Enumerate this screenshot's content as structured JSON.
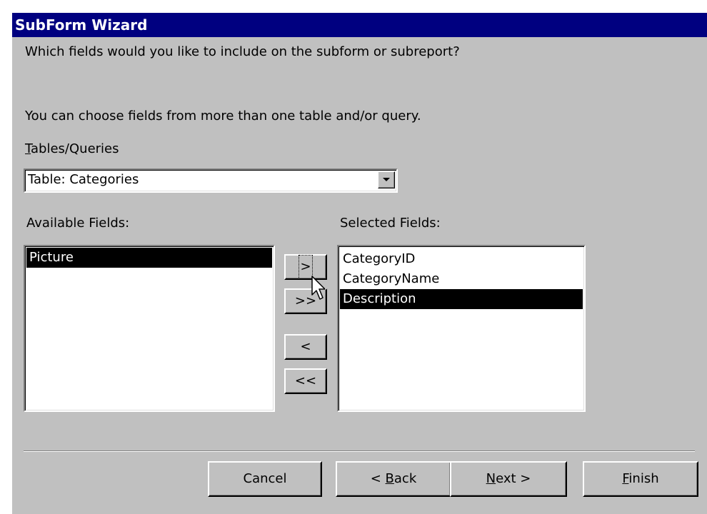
{
  "window": {
    "title": "SubForm Wizard"
  },
  "instructions": {
    "question": "Which fields would you like to include on the subform or subreport?",
    "hint": "You can choose fields from more than one table and/or query."
  },
  "tables_queries": {
    "label_accel": "T",
    "label_rest": "ables/Queries",
    "value": "Table: Categories"
  },
  "available": {
    "label": "Available Fields:",
    "items": [
      {
        "label": "Picture",
        "selected": true
      }
    ]
  },
  "selected": {
    "label": "Selected Fields:",
    "items": [
      {
        "label": "CategoryID",
        "selected": false
      },
      {
        "label": "CategoryName",
        "selected": false
      },
      {
        "label": "Description",
        "selected": true
      }
    ]
  },
  "move_buttons": {
    "add_one": ">",
    "add_all": ">>",
    "remove_one": "<",
    "remove_all": "<<"
  },
  "footer": {
    "cancel": "Cancel",
    "back_prefix": "< ",
    "back_accel": "B",
    "back_rest": "ack",
    "next_accel": "N",
    "next_rest": "ext >",
    "finish_accel": "F",
    "finish_rest": "inish"
  },
  "icons": {
    "combo_arrow": "chevron-down-icon",
    "cursor": "mouse-pointer-icon"
  }
}
